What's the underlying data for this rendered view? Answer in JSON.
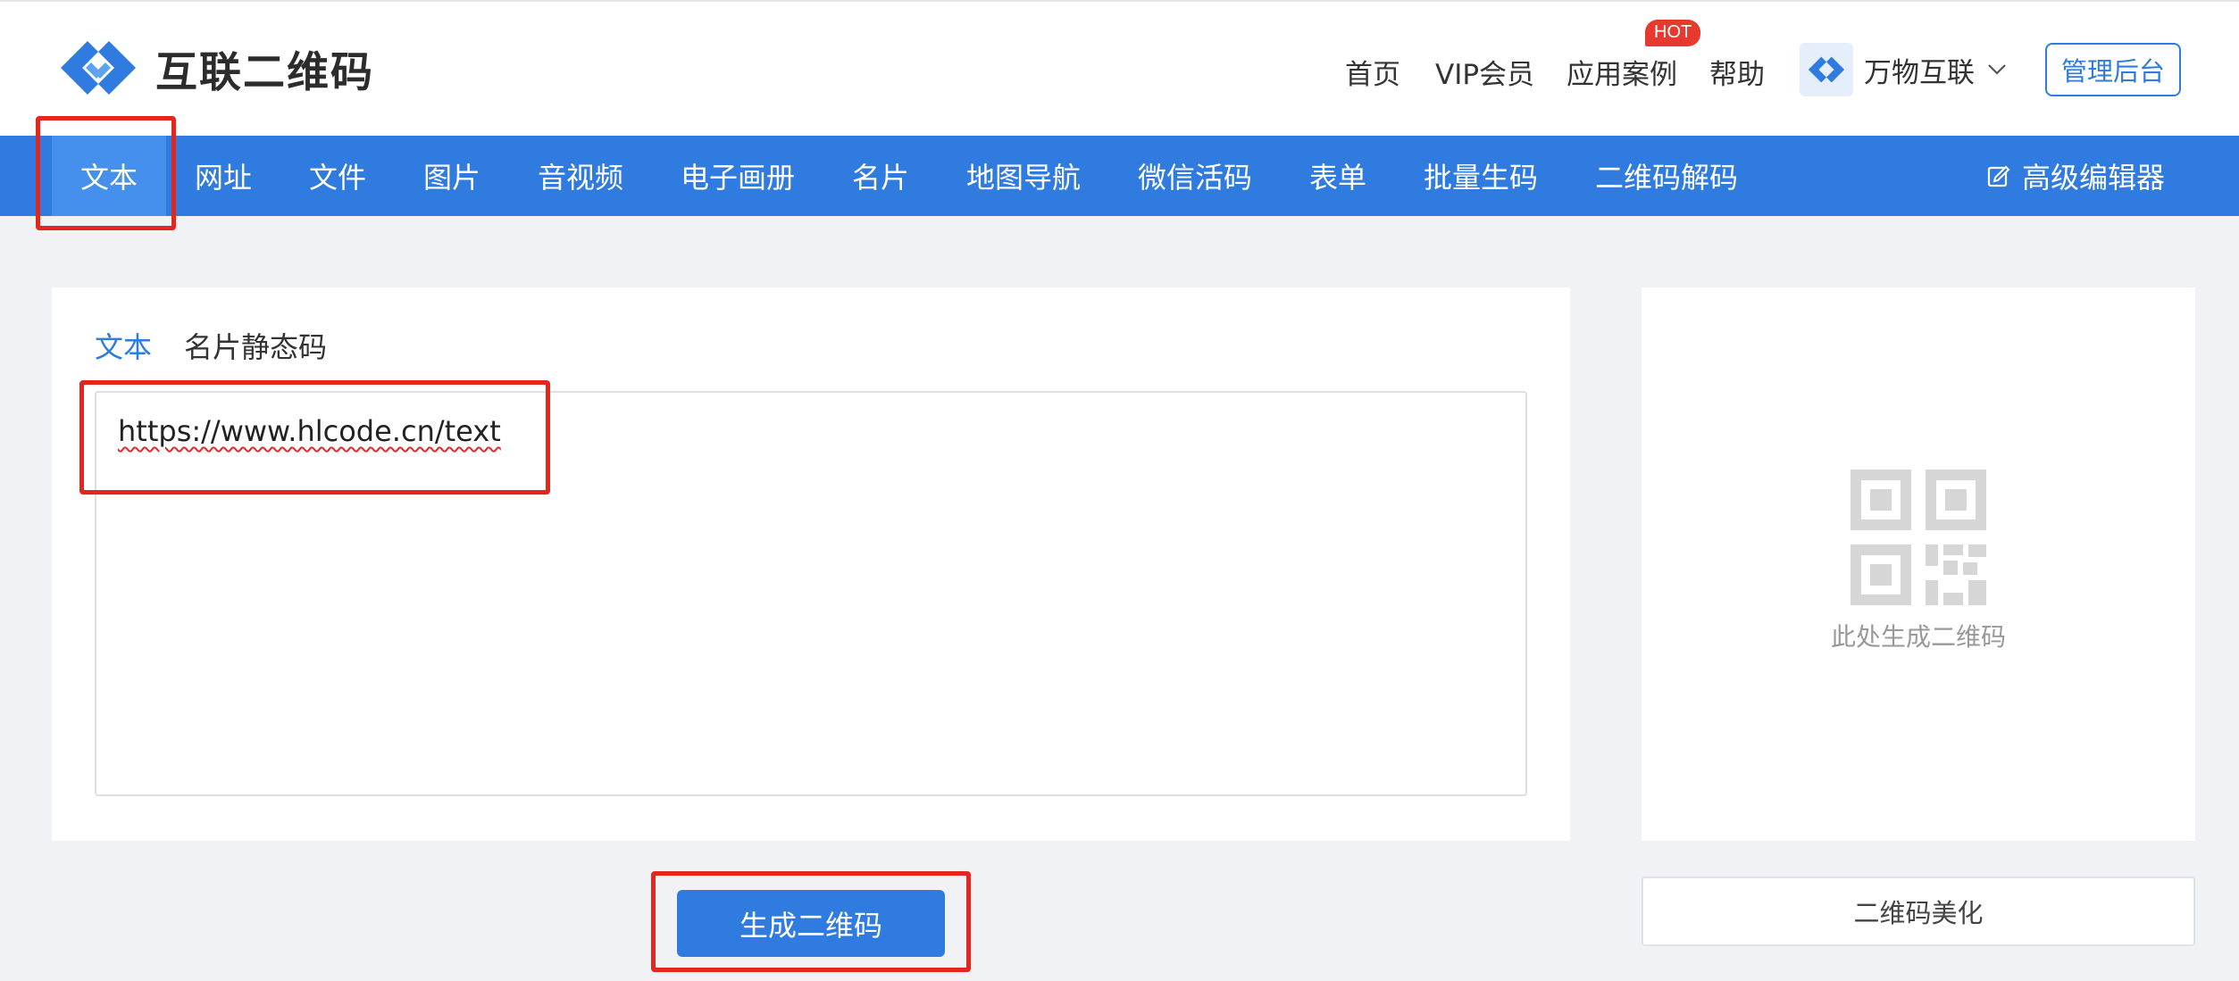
{
  "colors": {
    "primary": "#2f7be0",
    "annotation": "#e3261e",
    "hot": "#e8392f"
  },
  "header": {
    "logo_icon": "hlcode-logo-icon",
    "logo_text": "互联二维码",
    "nav": [
      {
        "label": "首页"
      },
      {
        "label": "VIP会员"
      },
      {
        "label": "应用案例"
      },
      {
        "label": "帮助"
      }
    ],
    "hot_badge": "HOT",
    "account_name": "万物互联",
    "account_icon": "chevron-down-icon",
    "admin_button": "管理后台"
  },
  "tabs": {
    "items": [
      {
        "label": "文本",
        "active": true
      },
      {
        "label": "网址"
      },
      {
        "label": "文件"
      },
      {
        "label": "图片"
      },
      {
        "label": "音视频"
      },
      {
        "label": "电子画册"
      },
      {
        "label": "名片"
      },
      {
        "label": "地图导航"
      },
      {
        "label": "微信活码"
      },
      {
        "label": "表单"
      },
      {
        "label": "批量生码"
      },
      {
        "label": "二维码解码"
      }
    ],
    "advanced_editor": "高级编辑器",
    "advanced_editor_icon": "edit-icon"
  },
  "editor": {
    "subtabs": [
      {
        "label": "文本",
        "active": true
      },
      {
        "label": "名片静态码"
      }
    ],
    "text_value": "https://www.hlcode.cn/text",
    "generate_button": "生成二维码"
  },
  "preview": {
    "placeholder_icon": "qr-placeholder-icon",
    "caption": "此处生成二维码",
    "beautify_button": "二维码美化"
  }
}
